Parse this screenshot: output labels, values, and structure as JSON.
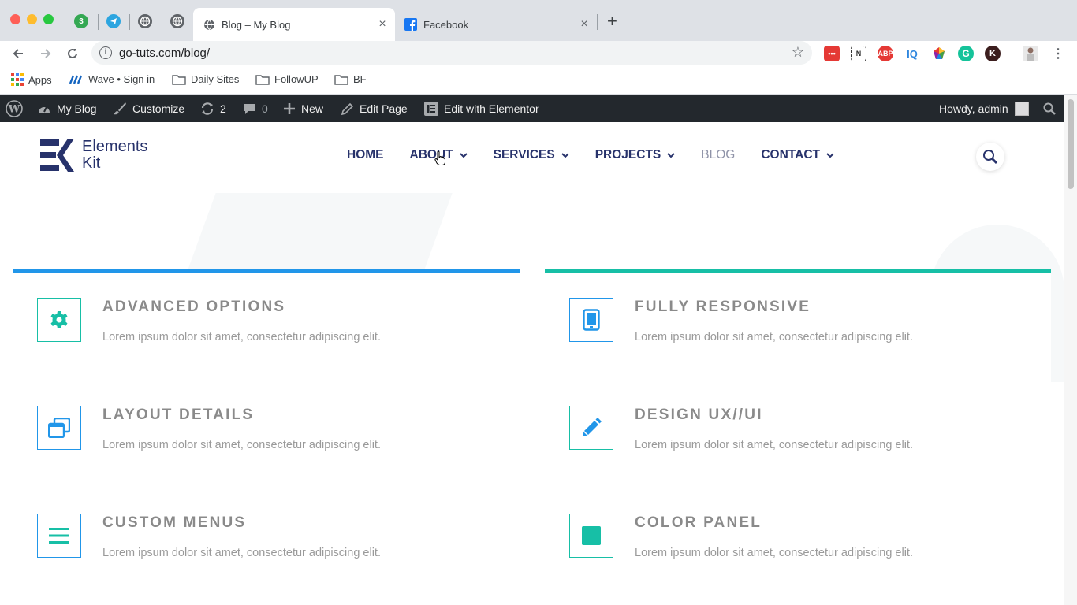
{
  "browser": {
    "pinned_badge": "3",
    "tabs": [
      {
        "title": "Blog – My Blog",
        "close": "×"
      },
      {
        "title": "Facebook",
        "close": "×"
      }
    ],
    "new_tab": "+",
    "url": "go-tuts.com/blog/",
    "bookmarks": [
      "Apps",
      "Wave • Sign in",
      "Daily Sites",
      "FollowUP",
      "BF"
    ],
    "extensions": [
      "ABP",
      "IQ"
    ]
  },
  "adminbar": {
    "site": "My Blog",
    "customize": "Customize",
    "updates": "2",
    "comments": "0",
    "new": "New",
    "edit_page": "Edit Page",
    "edit_elementor": "Edit with Elementor",
    "howdy": "Howdy, admin"
  },
  "site": {
    "logo_line1": "Elements",
    "logo_line2": "Kit",
    "nav": [
      "HOME",
      "ABOUT",
      "SERVICES",
      "PROJECTS",
      "BLOG",
      "CONTACT"
    ]
  },
  "features": {
    "left": [
      {
        "title": "ADVANCED OPTIONS",
        "desc": "Lorem ipsum dolor sit amet, consectetur adipiscing elit.",
        "icon": "gear-icon"
      },
      {
        "title": "LAYOUT DETAILS",
        "desc": "Lorem ipsum dolor sit amet, consectetur adipiscing elit.",
        "icon": "windows-icon"
      },
      {
        "title": "CUSTOM MENUS",
        "desc": "Lorem ipsum dolor sit amet, consectetur adipiscing elit.",
        "icon": "menu-icon"
      }
    ],
    "right": [
      {
        "title": "FULLY RESPONSIVE",
        "desc": "Lorem ipsum dolor sit amet, consectetur adipiscing elit.",
        "icon": "tablet-icon"
      },
      {
        "title": "DESIGN UX//UI",
        "desc": "Lorem ipsum dolor sit amet, consectetur adipiscing elit.",
        "icon": "pencil-icon"
      },
      {
        "title": "COLOR PANEL",
        "desc": "Lorem ipsum dolor sit amet, consectetur adipiscing elit.",
        "icon": "square-icon"
      }
    ]
  },
  "colors": {
    "brand_navy": "#27326b",
    "accent_blue": "#2196e9",
    "accent_teal": "#17bfa6",
    "adminbar_bg": "#23282d"
  }
}
